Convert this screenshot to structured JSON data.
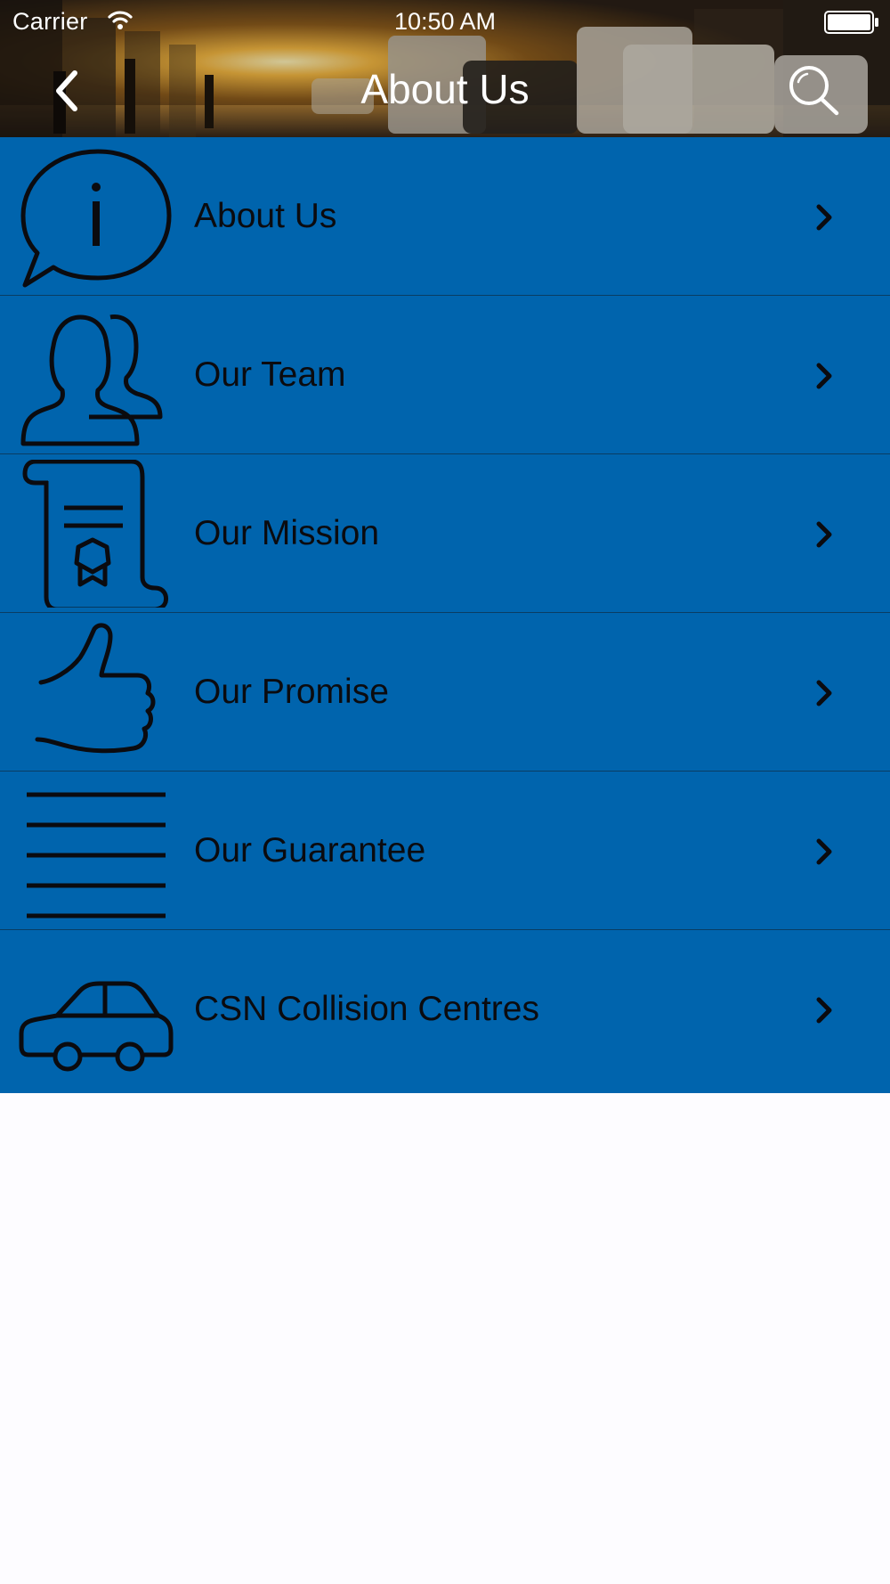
{
  "status_bar": {
    "carrier": "Carrier",
    "time": "10:50 AM"
  },
  "nav": {
    "title": "About Us",
    "back_icon": "chevron-left-icon",
    "search_icon": "search-icon"
  },
  "menu": {
    "items": [
      {
        "label": "About Us",
        "icon": "info-bubble-icon"
      },
      {
        "label": "Our Team",
        "icon": "team-icon"
      },
      {
        "label": "Our Mission",
        "icon": "certificate-scroll-icon"
      },
      {
        "label": "Our Promise",
        "icon": "thumbs-up-icon"
      },
      {
        "label": "Our Guarantee",
        "icon": "lines-icon"
      },
      {
        "label": "CSN Collision Centres",
        "icon": "car-icon"
      }
    ]
  },
  "colors": {
    "menu_background": "#0064ad",
    "divider": "#0a3d63",
    "page_background": "#fdfcff",
    "text_dark": "#0b0b0f",
    "header_text": "#ffffff"
  }
}
